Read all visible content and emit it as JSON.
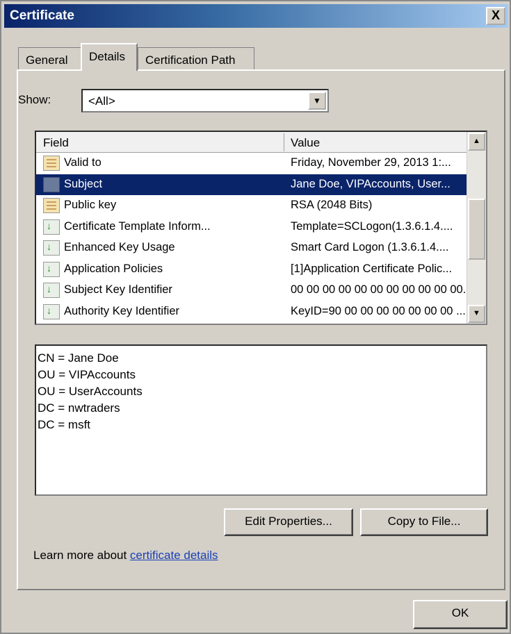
{
  "window": {
    "title": "Certificate",
    "close_label": "X"
  },
  "tabs": [
    {
      "label": "General",
      "active": false
    },
    {
      "label": "Details",
      "active": true
    },
    {
      "label": "Certification Path",
      "active": false
    }
  ],
  "show": {
    "label": "Show:",
    "value": "<All>"
  },
  "list": {
    "columns": {
      "field": "Field",
      "value": "Value"
    },
    "rows": [
      {
        "field": "Valid to",
        "value": "Friday, November 29, 2013 1:...",
        "icon": "certificate-field-icon"
      },
      {
        "field": "Subject",
        "value": "Jane Doe, VIPAccounts, User...",
        "icon": "certificate-field-icon",
        "selected": true
      },
      {
        "field": "Public key",
        "value": "RSA (2048 Bits)",
        "icon": "certificate-field-icon"
      },
      {
        "field": "Certificate Template Inform...",
        "value": "Template=SCLogon(1.3.6.1.4....",
        "icon": "extension-icon"
      },
      {
        "field": "Enhanced Key Usage",
        "value": "Smart Card Logon (1.3.6.1.4....",
        "icon": "extension-icon"
      },
      {
        "field": "Application Policies",
        "value": "[1]Application Certificate Polic...",
        "icon": "extension-icon"
      },
      {
        "field": "Subject Key Identifier",
        "value": "00 00 00 00 00 00 00 00 00 00 00...",
        "icon": "extension-icon"
      },
      {
        "field": "Authority Key Identifier",
        "value": "KeyID=90 00 00 00 00 00 00 00 ...",
        "icon": "extension-icon"
      }
    ]
  },
  "detail_lines": [
    "CN = Jane Doe",
    "OU = VIPAccounts",
    "OU = UserAccounts",
    "DC = nwtraders",
    "DC = msft"
  ],
  "buttons": {
    "edit_properties": "Edit Properties...",
    "copy_to_file": "Copy to File...",
    "ok": "OK"
  },
  "learn_more": {
    "prefix": "Learn more about ",
    "link": "certificate details"
  },
  "colors": {
    "selection": "#0a246a",
    "link": "#1a3fb5",
    "face": "#d4d0c8"
  }
}
